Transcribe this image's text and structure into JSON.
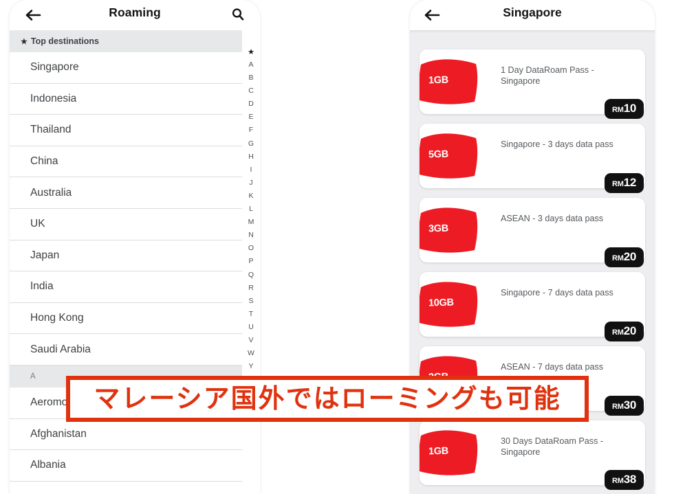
{
  "left_screen": {
    "appbar": {
      "back_icon": "arrow-left-icon",
      "title": "Roaming",
      "search_icon": "search-icon"
    },
    "sections": [
      {
        "header": "Top destinations",
        "header_icon": "star-icon",
        "items": [
          "Singapore",
          "Indonesia",
          "Thailand",
          "China",
          "Australia",
          "UK",
          "Japan",
          "India",
          "Hong Kong",
          "Saudi Arabia"
        ]
      },
      {
        "header": "A",
        "items": [
          "Aeromobile",
          "Afghanistan",
          "Albania"
        ]
      }
    ],
    "alpha_index": [
      "★",
      "A",
      "B",
      "C",
      "D",
      "E",
      "F",
      "G",
      "H",
      "I",
      "J",
      "K",
      "L",
      "M",
      "N",
      "O",
      "P",
      "Q",
      "R",
      "S",
      "T",
      "U",
      "V",
      "W",
      "Y"
    ]
  },
  "right_screen": {
    "appbar": {
      "back_icon": "arrow-left-icon",
      "title": "Singapore"
    },
    "passes": [
      {
        "data": "1GB",
        "title": "1 Day DataRoam Pass - Singapore",
        "currency": "RM",
        "amount": "10"
      },
      {
        "data": "5GB",
        "title": "Singapore - 3 days data pass",
        "currency": "RM",
        "amount": "12"
      },
      {
        "data": "3GB",
        "title": "ASEAN - 3 days data pass",
        "currency": "RM",
        "amount": "20"
      },
      {
        "data": "10GB",
        "title": "Singapore - 7 days data pass",
        "currency": "RM",
        "amount": "20"
      },
      {
        "data": "3GB",
        "title": "ASEAN - 7 days data pass",
        "currency": "RM",
        "amount": "30"
      },
      {
        "data": "1GB",
        "title": "30 Days DataRoam Pass - Singapore",
        "currency": "RM",
        "amount": "38"
      }
    ]
  },
  "caption_overlay": {
    "text": "マレーシア国外ではローミングも可能"
  },
  "colors": {
    "brand_red": "#ED1C24",
    "caption_red": "#E0320F",
    "badge_black": "#111111",
    "panel_bg": "#EEEEF0",
    "section_header_bg": "#E7E8EA"
  }
}
